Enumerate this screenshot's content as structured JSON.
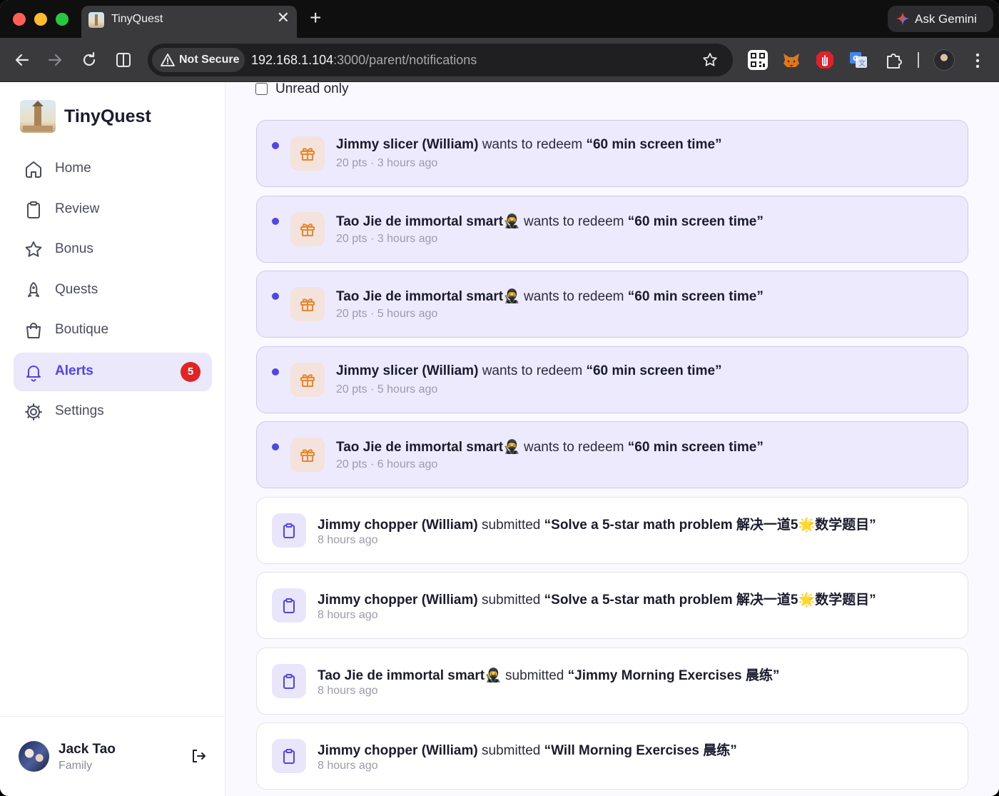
{
  "browser": {
    "tab_title": "TinyQuest",
    "tab_close": "✕",
    "new_tab": "+",
    "ask_gemini": "Ask Gemini",
    "not_secure": "Not Secure",
    "url_host": "192.168.1.104",
    "url_path": ":3000/parent/notifications"
  },
  "app": {
    "name": "TinyQuest"
  },
  "sidebar": {
    "items": [
      {
        "label": "Home",
        "icon": "home-icon"
      },
      {
        "label": "Review",
        "icon": "clipboard-icon"
      },
      {
        "label": "Bonus",
        "icon": "star-icon"
      },
      {
        "label": "Quests",
        "icon": "rocket-icon"
      },
      {
        "label": "Boutique",
        "icon": "shopping-bag-icon"
      },
      {
        "label": "Alerts",
        "icon": "bell-icon",
        "active": true,
        "badge": "5"
      },
      {
        "label": "Settings",
        "icon": "gear-icon"
      }
    ],
    "user": {
      "name": "Jack Tao",
      "role": "Family"
    }
  },
  "filter": {
    "label": "Unread only",
    "checked": false
  },
  "notifications": [
    {
      "type": "redeem",
      "unread": true,
      "actor": "Jimmy slicer (William)",
      "verb": "wants to redeem",
      "target": "“60 min screen time”",
      "meta": "20 pts · 3 hours ago"
    },
    {
      "type": "redeem",
      "unread": true,
      "actor": "Tao Jie de immortal smart🥷",
      "verb": "wants to redeem",
      "target": "“60 min screen time”",
      "meta": "20 pts · 3 hours ago"
    },
    {
      "type": "redeem",
      "unread": true,
      "actor": "Tao Jie de immortal smart🥷",
      "verb": "wants to redeem",
      "target": "“60 min screen time”",
      "meta": "20 pts · 5 hours ago"
    },
    {
      "type": "redeem",
      "unread": true,
      "actor": "Jimmy slicer (William)",
      "verb": "wants to redeem",
      "target": "“60 min screen time”",
      "meta": "20 pts · 5 hours ago"
    },
    {
      "type": "redeem",
      "unread": true,
      "actor": "Tao Jie de immortal smart🥷",
      "verb": "wants to redeem",
      "target": "“60 min screen time”",
      "meta": "20 pts · 6 hours ago"
    },
    {
      "type": "submit",
      "unread": false,
      "actor": "Jimmy chopper (William)",
      "verb": "submitted",
      "target": "“Solve a 5-star math problem 解决一道5🌟数学题目”",
      "meta": "8 hours ago"
    },
    {
      "type": "submit",
      "unread": false,
      "actor": "Jimmy chopper (William)",
      "verb": "submitted",
      "target": "“Solve a 5-star math problem 解决一道5🌟数学题目”",
      "meta": "8 hours ago"
    },
    {
      "type": "submit",
      "unread": false,
      "actor": "Tao Jie de immortal smart🥷",
      "verb": "submitted",
      "target": "“Jimmy Morning Exercises 晨练”",
      "meta": "8 hours ago"
    },
    {
      "type": "submit",
      "unread": false,
      "actor": "Jimmy chopper (William)",
      "verb": "submitted",
      "target": "“Will Morning Exercises 晨练”",
      "meta": "8 hours ago"
    }
  ],
  "colors": {
    "accent": "#4f46e5",
    "unread_bg": "#eeeafd",
    "badge": "#e02424",
    "gift": "#e8872c"
  }
}
